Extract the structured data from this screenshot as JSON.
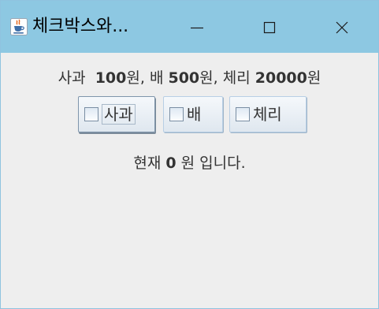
{
  "window": {
    "title": "체크박스와...",
    "icon": "java-coffee-cup-icon",
    "controls": {
      "minimize": "minimize-icon",
      "maximize": "maximize-icon",
      "close": "close-icon"
    },
    "titlebar_color": "#8dc8e2",
    "background_color": "#eeeeee"
  },
  "price_info": {
    "apple_label": "사과",
    "apple_price": "100",
    "apple_unit": "원,",
    "pear_label": "배",
    "pear_price": "500",
    "pear_unit": "원,",
    "cherry_label": "체리",
    "cherry_price": "20000",
    "cherry_unit": "원"
  },
  "checkboxes": [
    {
      "label": "사과",
      "checked": false,
      "focused": true
    },
    {
      "label": "배",
      "checked": false,
      "focused": false
    },
    {
      "label": "체리",
      "checked": false,
      "focused": false
    }
  ],
  "total": {
    "prefix": "현재",
    "amount": "0",
    "suffix": "원 입니다."
  }
}
